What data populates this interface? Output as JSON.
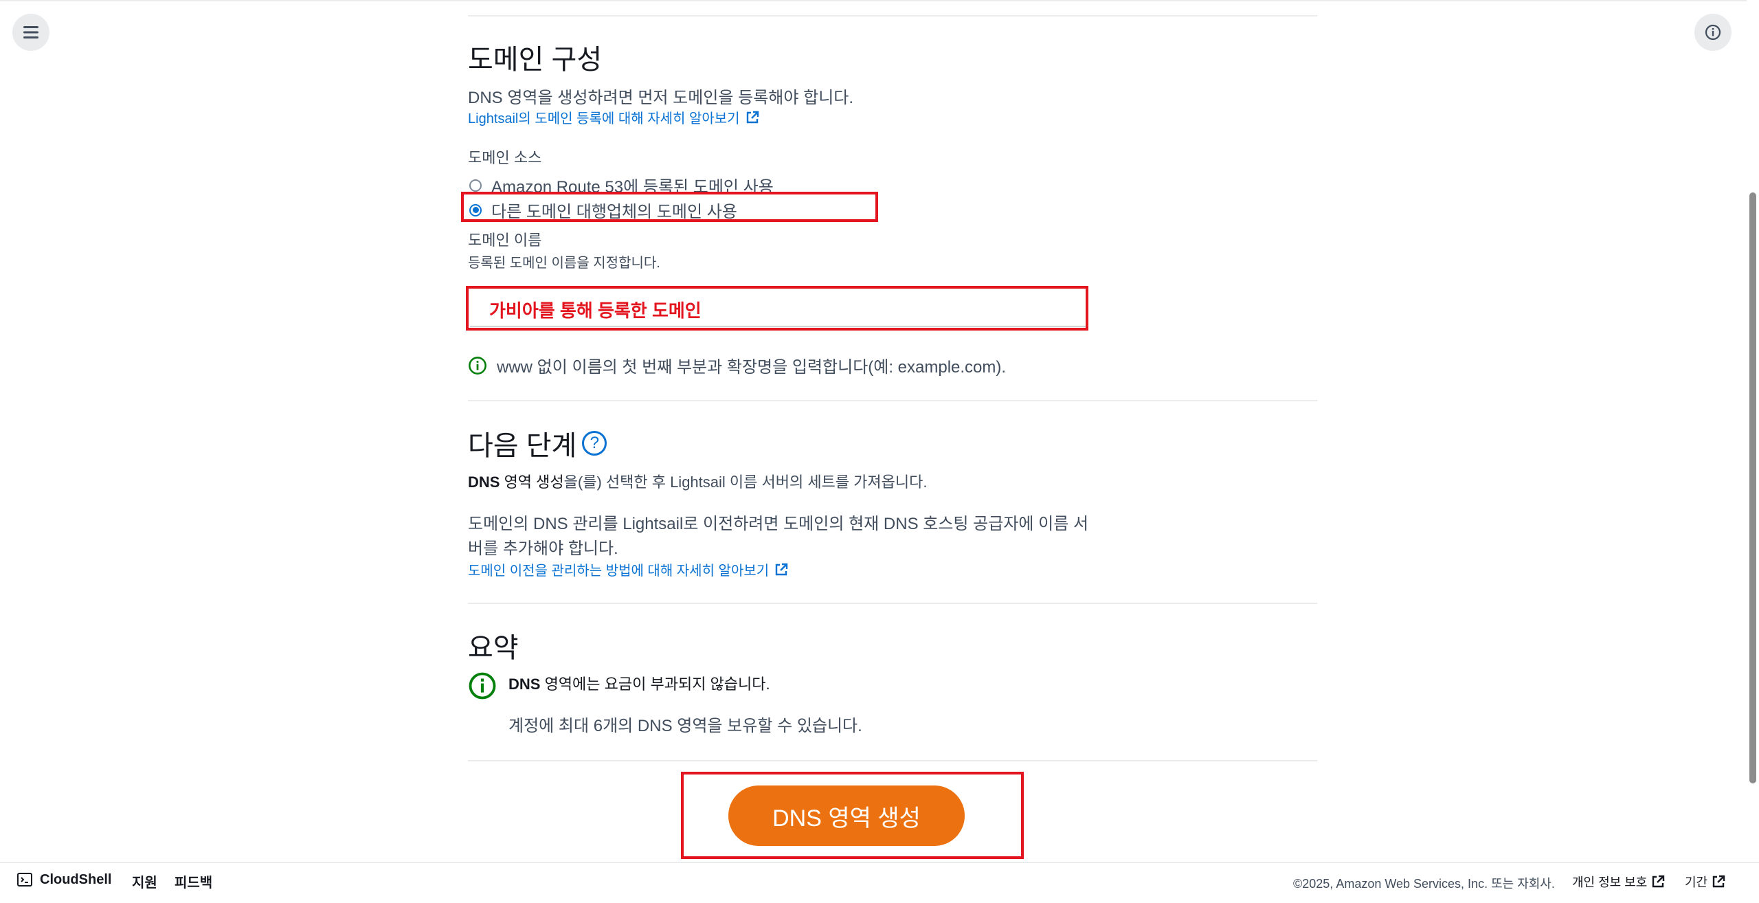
{
  "domain_config": {
    "title": "도메인 구성",
    "description": "DNS 영역을 생성하려면 먼저 도메인을 등록해야 합니다.",
    "learn_more_link": "Lightsail의 도메인 등록에 대해 자세히 알아보기",
    "source_label": "도메인 소스",
    "options": [
      "Amazon Route 53에 등록된 도메인 사용",
      "다른 도메인 대행업체의 도메인 사용"
    ],
    "selected_option": 1,
    "name_label": "도메인 이름",
    "name_description": "등록된 도메인 이름을 지정합니다.",
    "name_value": "가비아를 통해 등록한 도메인",
    "name_hint": "www 없이 이름의 첫 번째 부분과 확장명을 입력합니다(예: example.com)."
  },
  "next_steps": {
    "title": "다음 단계",
    "help_symbol": "?",
    "line1_bold": "DNS",
    "line1_bold2": " 영역 생성",
    "line1_rest": "을(를) 선택한 후 Lightsail 이름 서버의 세트를 가져옵니다.",
    "line2a": "도메인의 DNS 관리를 Lightsail로 이전하려면 도메인의 현재 DNS 호스팅 공급자에 이름 서",
    "line2b": "버를 추가해야 합니다.",
    "link": "도메인 이전을 관리하는 방법에 대해 자세히 알아보기"
  },
  "summary": {
    "title": "요약",
    "line1_bold": "DNS",
    "line1_rest": " 영역에는 요금이 부과되지 않습니다.",
    "line2": "계정에 최대 6개의 DNS 영역을 보유할 수 있습니다."
  },
  "create_button": "DNS 영역 생성",
  "footer": {
    "cloudshell": "CloudShell",
    "support": "지원",
    "feedback": "피드백",
    "copyright": "©2025, Amazon Web Services, Inc. 또는 자회사.",
    "privacy": "개인 정보 보호",
    "terms": "기간"
  },
  "colors": {
    "accent": "#0972d3",
    "primary_button": "#ec7211",
    "highlight": "#e3151f",
    "success": "#037f0c"
  }
}
